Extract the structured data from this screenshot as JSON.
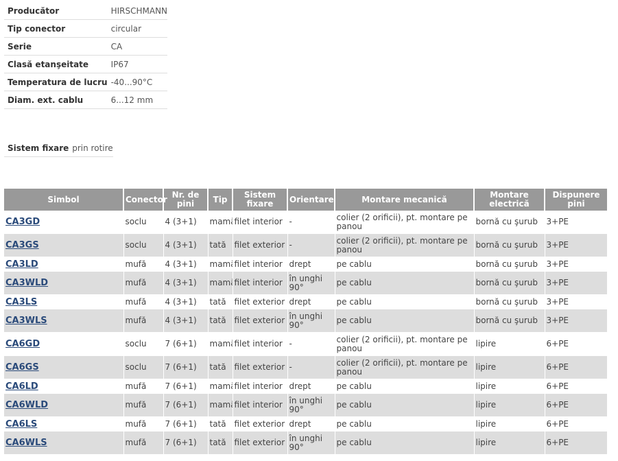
{
  "specs": [
    {
      "label": "Producător",
      "value": "HIRSCHMANN"
    },
    {
      "label": "Tip conector",
      "value": "circular"
    },
    {
      "label": "Serie",
      "value": "CA"
    },
    {
      "label": "Clasă etanşeitate",
      "value": "IP67"
    },
    {
      "label": "Temperatura de lucru",
      "value": "-40...90°C"
    },
    {
      "label": "Diam. ext. cablu",
      "value": "6...12 mm"
    }
  ],
  "fixing": {
    "label": "Sistem fixare",
    "value": "prin rotire"
  },
  "table": {
    "headers": [
      "Simbol",
      "Conector",
      "Nr. de pini",
      "Tip",
      "Sistem fixare",
      "Orientare",
      "Montare mecanică",
      "Montare electrică",
      "Dispunere pini"
    ],
    "rows": [
      [
        "CA3GD",
        "soclu",
        "4 (3+1)",
        "mamă",
        "filet interior",
        "-",
        "colier (2 orificii), pt. montare pe panou",
        "bornă cu şurub",
        "3+PE"
      ],
      [
        "CA3GS",
        "soclu",
        "4 (3+1)",
        "tată",
        "filet exterior",
        "-",
        "colier (2 orificii), pt. montare pe panou",
        "bornă cu şurub",
        "3+PE"
      ],
      [
        "CA3LD",
        "mufă",
        "4 (3+1)",
        "mamă",
        "filet interior",
        "drept",
        "pe cablu",
        "bornă cu şurub",
        "3+PE"
      ],
      [
        "CA3WLD",
        "mufă",
        "4 (3+1)",
        "mamă",
        "filet interior",
        "în unghi 90°",
        "pe cablu",
        "bornă cu şurub",
        "3+PE"
      ],
      [
        "CA3LS",
        "mufă",
        "4 (3+1)",
        "tată",
        "filet exterior",
        "drept",
        "pe cablu",
        "bornă cu şurub",
        "3+PE"
      ],
      [
        "CA3WLS",
        "mufă",
        "4 (3+1)",
        "tată",
        "filet exterior",
        "în unghi 90°",
        "pe cablu",
        "bornă cu şurub",
        "3+PE"
      ],
      [
        "CA6GD",
        "soclu",
        "7 (6+1)",
        "mamă",
        "filet interior",
        "-",
        "colier (2 orificii), pt. montare pe panou",
        "lipire",
        "6+PE"
      ],
      [
        "CA6GS",
        "soclu",
        "7 (6+1)",
        "tată",
        "filet exterior",
        "-",
        "colier (2 orificii), pt. montare pe panou",
        "lipire",
        "6+PE"
      ],
      [
        "CA6LD",
        "mufă",
        "7 (6+1)",
        "mamă",
        "filet interior",
        "drept",
        "pe cablu",
        "lipire",
        "6+PE"
      ],
      [
        "CA6WLD",
        "mufă",
        "7 (6+1)",
        "mamă",
        "filet interior",
        "în unghi 90°",
        "pe cablu",
        "lipire",
        "6+PE"
      ],
      [
        "CA6LS",
        "mufă",
        "7 (6+1)",
        "tată",
        "filet exterior",
        "drept",
        "pe cablu",
        "lipire",
        "6+PE"
      ],
      [
        "CA6WLS",
        "mufă",
        "7 (6+1)",
        "tată",
        "filet exterior",
        "în unghi 90°",
        "pe cablu",
        "lipire",
        "6+PE"
      ]
    ]
  }
}
